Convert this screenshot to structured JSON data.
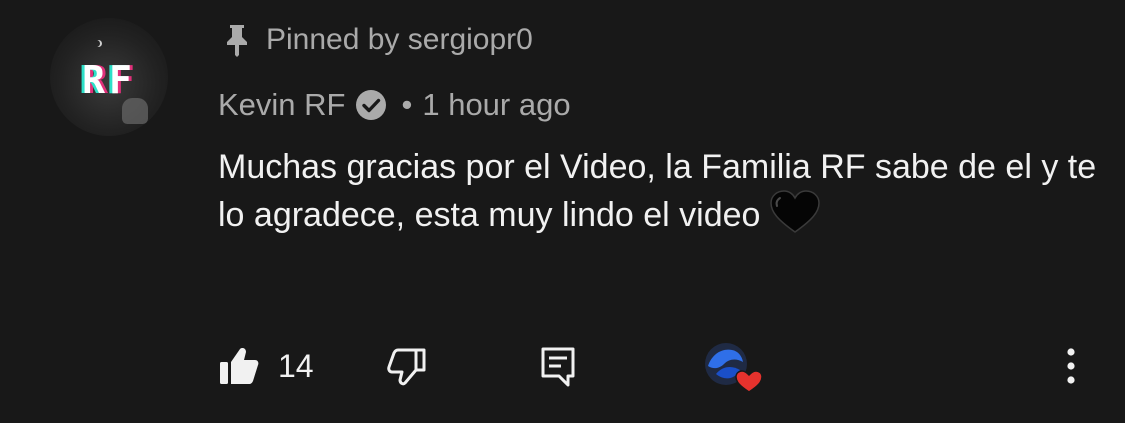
{
  "comment": {
    "avatar_text": "RF",
    "pinned_label": "Pinned by sergiopr0",
    "author": "Kevin RF",
    "separator": "•",
    "timestamp": "1 hour ago",
    "text": "Muchas gracias por el Video, la Familia RF sabe de el y te lo agradece, esta muy lindo el video",
    "emoji": "black-heart"
  },
  "actions": {
    "like_count": "14",
    "icons": [
      "thumbs-up-icon",
      "thumbs-down-icon",
      "reply-icon",
      "creator-heart-icon",
      "more-vert-icon"
    ]
  },
  "colors": {
    "background": "#181818",
    "primary_text": "#f1f1f1",
    "secondary_text": "#aaaaaa",
    "heart_red": "#e5322d",
    "creator_blue": "#2f6fe8"
  }
}
